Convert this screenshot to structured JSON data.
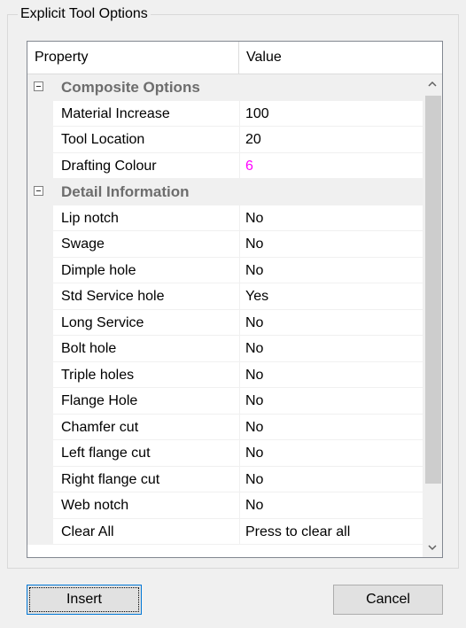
{
  "group_title": "Explicit Tool Options",
  "grid": {
    "headers": {
      "property": "Property",
      "value": "Value"
    },
    "composite": {
      "title": "Composite Options",
      "rows": [
        {
          "label": "Material Increase",
          "value": "100"
        },
        {
          "label": "Tool Location",
          "value": "20"
        },
        {
          "label": "Drafting Colour",
          "value": "6"
        }
      ]
    },
    "detail": {
      "title": "Detail Information",
      "rows": [
        {
          "label": "Lip notch",
          "value": "No"
        },
        {
          "label": "Swage",
          "value": "No"
        },
        {
          "label": "Dimple hole",
          "value": "No"
        },
        {
          "label": "Std Service hole",
          "value": "Yes"
        },
        {
          "label": "Long Service",
          "value": "No"
        },
        {
          "label": "Bolt hole",
          "value": "No"
        },
        {
          "label": "Triple holes",
          "value": "No"
        },
        {
          "label": "Flange Hole",
          "value": "No"
        },
        {
          "label": "Chamfer cut",
          "value": "No"
        },
        {
          "label": "Left flange cut",
          "value": "No"
        },
        {
          "label": "Right flange cut",
          "value": "No"
        },
        {
          "label": "Web notch",
          "value": "No"
        },
        {
          "label": "Clear All",
          "value": "Press to clear all"
        }
      ]
    }
  },
  "colors": {
    "drafting_colour_value": "#ff00ff",
    "category_text": "#6d6d6d"
  },
  "icons": {
    "collapse": "minus-box-icon",
    "scroll_up": "chevron-up-icon",
    "scroll_down": "chevron-down-icon"
  },
  "buttons": {
    "insert": "Insert",
    "cancel": "Cancel"
  }
}
